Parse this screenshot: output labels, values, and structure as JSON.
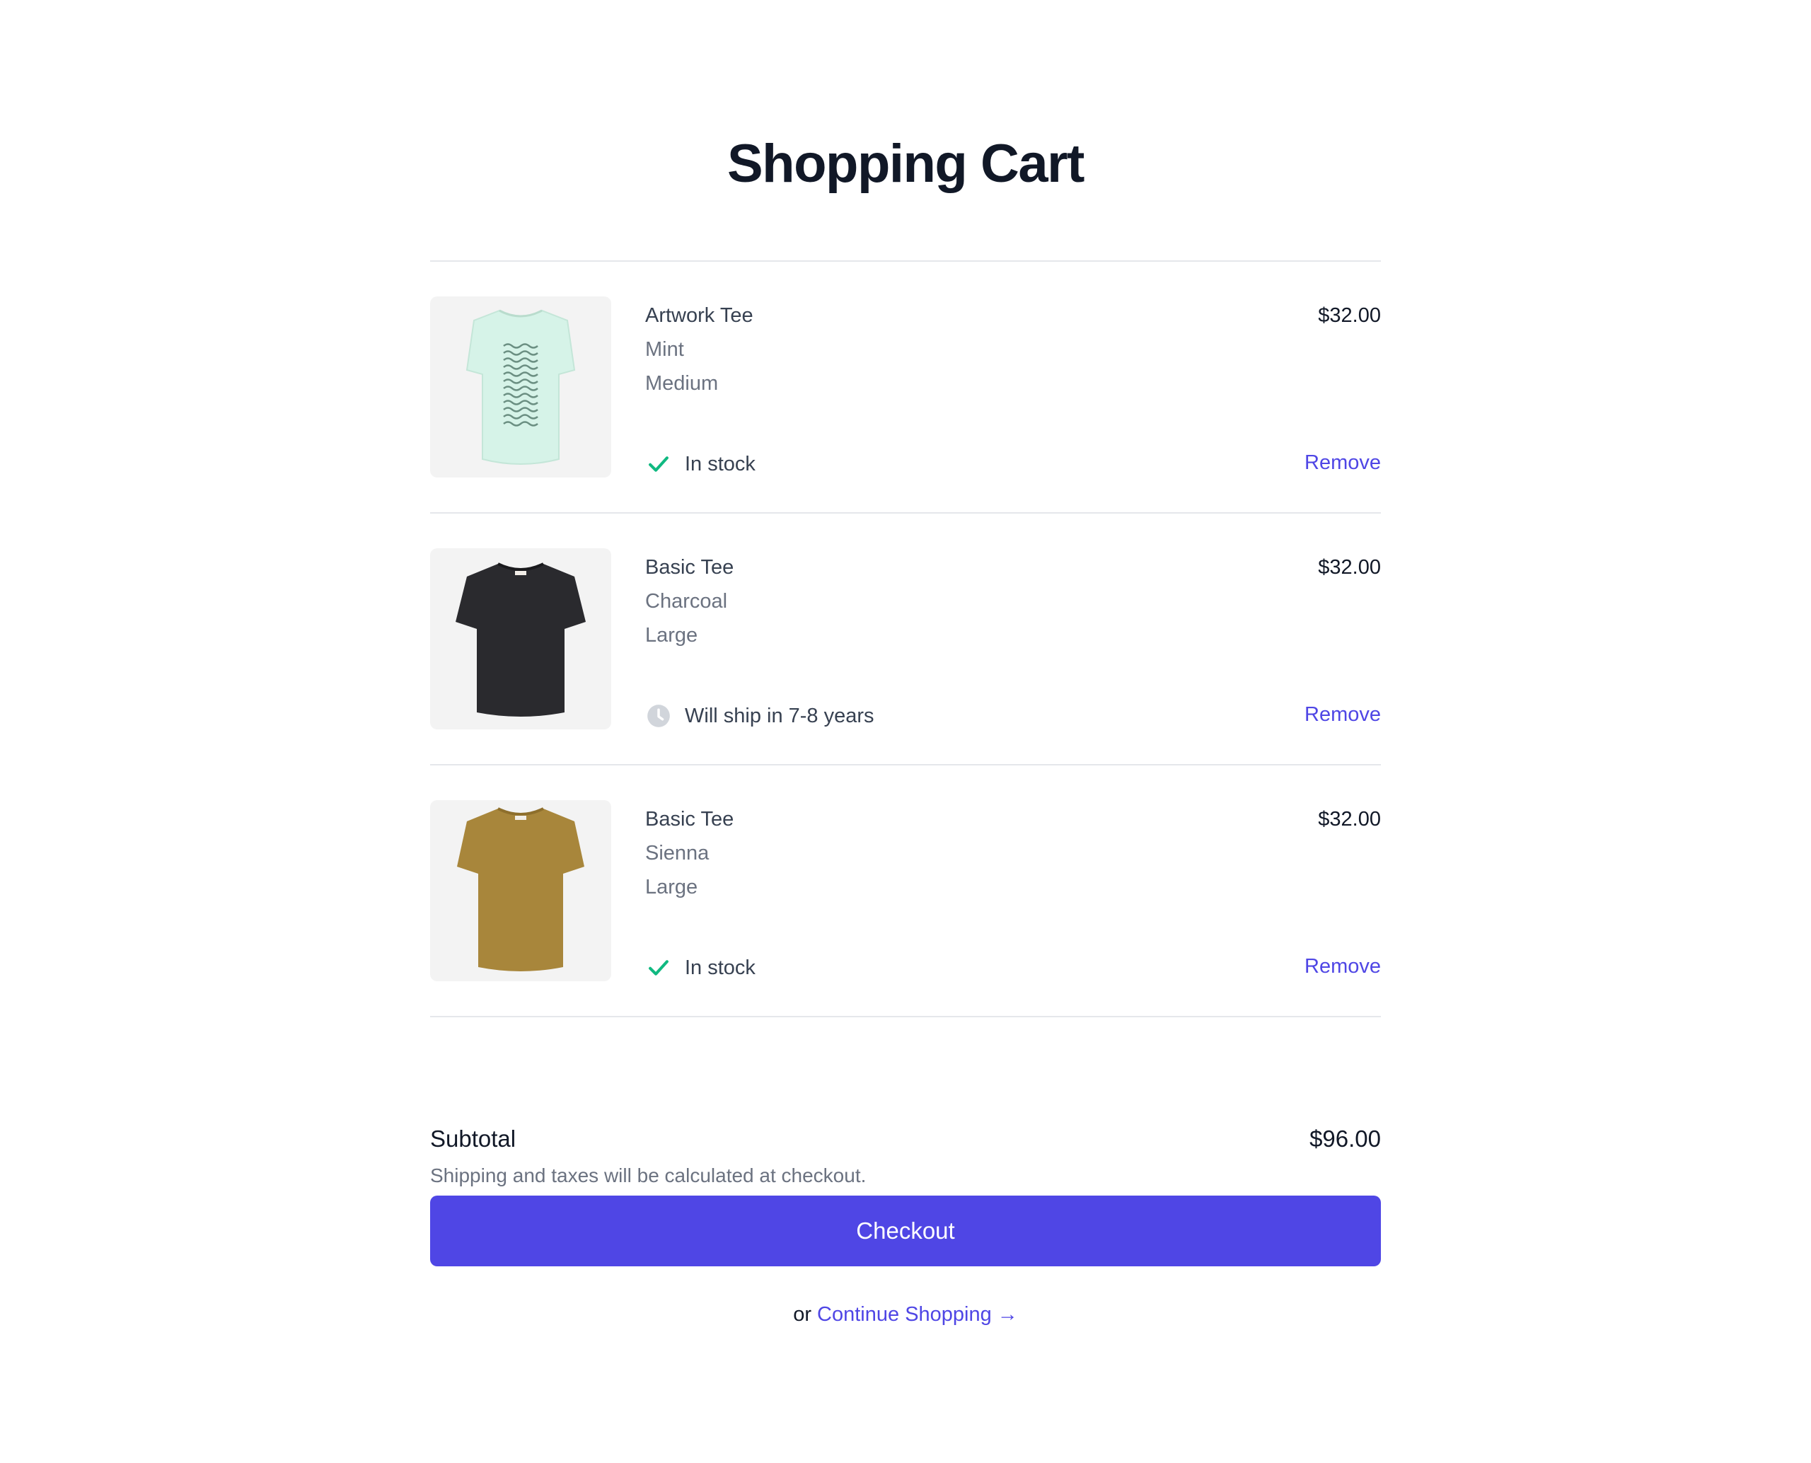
{
  "page": {
    "title": "Shopping Cart"
  },
  "items": [
    {
      "name": "Artwork Tee",
      "color": "Mint",
      "size": "Medium",
      "price": "$32.00",
      "status": "In stock",
      "status_icon": "check-icon",
      "remove_label": "Remove",
      "shirt_color": "#d6f3e8"
    },
    {
      "name": "Basic Tee",
      "color": "Charcoal",
      "size": "Large",
      "price": "$32.00",
      "status": "Will ship in 7-8 years",
      "status_icon": "clock-icon",
      "remove_label": "Remove",
      "shirt_color": "#2a2a2e"
    },
    {
      "name": "Basic Tee",
      "color": "Sienna",
      "size": "Large",
      "price": "$32.00",
      "status": "In stock",
      "status_icon": "check-icon",
      "remove_label": "Remove",
      "shirt_color": "#a8863b"
    }
  ],
  "summary": {
    "subtotal_label": "Subtotal",
    "subtotal_value": "$96.00",
    "note": "Shipping and taxes will be calculated at checkout."
  },
  "checkout_label": "Checkout",
  "continue": {
    "prefix": "or",
    "link_label": "Continue Shopping →"
  },
  "colors": {
    "accent": "#4f46e5",
    "in_stock": "#10b981",
    "backorder": "#d1d5db"
  }
}
